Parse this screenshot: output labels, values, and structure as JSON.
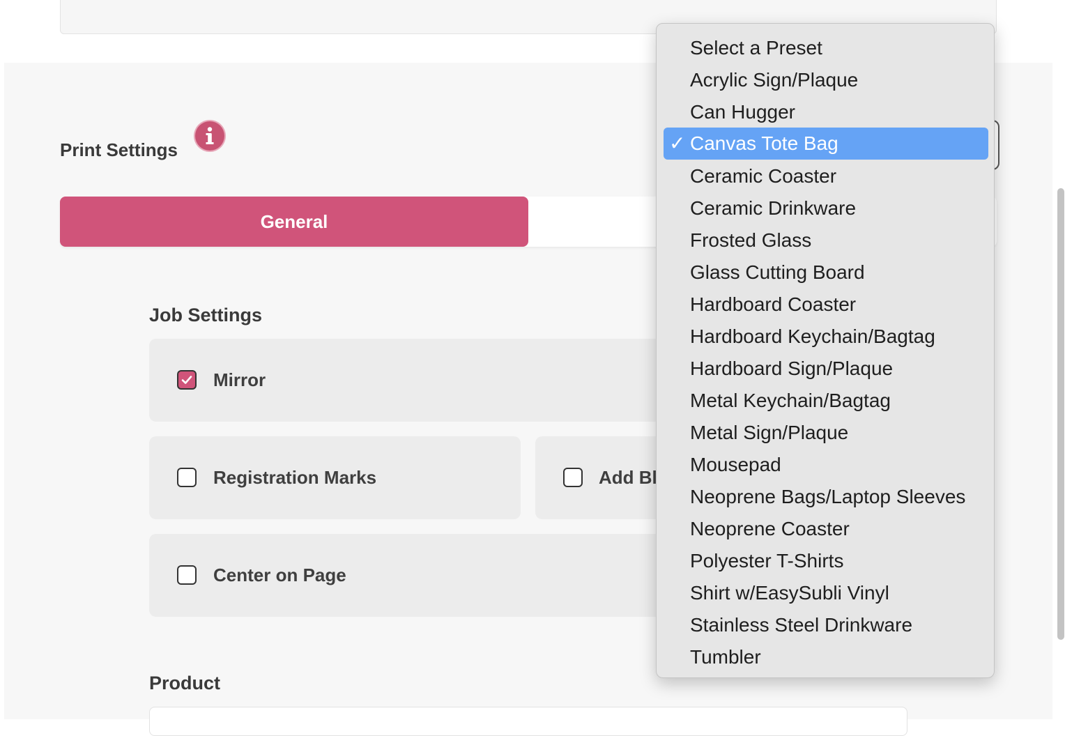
{
  "print_settings": {
    "title": "Print Settings",
    "tabs": {
      "general": "General"
    }
  },
  "job_settings": {
    "title": "Job Settings",
    "mirror": {
      "label": "Mirror",
      "checked": true
    },
    "registration_marks": {
      "label": "Registration Marks",
      "checked": false
    },
    "add_bleed": {
      "label": "Add Ble",
      "checked": false
    },
    "center_on_page": {
      "label": "Center on Page",
      "checked": false
    }
  },
  "product": {
    "title": "Product"
  },
  "preset_dropdown": {
    "selected": "Canvas Tote Bag",
    "check_glyph": "✓",
    "options": [
      "Select a Preset",
      "Acrylic Sign/Plaque",
      "Can Hugger",
      "Canvas Tote Bag",
      "Ceramic Coaster",
      "Ceramic Drinkware",
      "Frosted Glass",
      "Glass Cutting Board",
      "Hardboard Coaster",
      "Hardboard Keychain/Bagtag",
      "Hardboard Sign/Plaque",
      "Metal Keychain/Bagtag",
      "Metal Sign/Plaque",
      "Mousepad",
      "Neoprene Bags/Laptop Sleeves",
      "Neoprene Coaster",
      "Polyester T-Shirts",
      "Shirt w/EasySubli Vinyl",
      "Stainless Steel Drinkware",
      "Tumbler"
    ]
  },
  "colors": {
    "accent": "#d0547a",
    "selection": "#65a3f5",
    "panel": "#f7f7f7",
    "card": "#ececec"
  },
  "icons": {
    "info": "info-icon",
    "checkmark": "checkmark-icon"
  }
}
